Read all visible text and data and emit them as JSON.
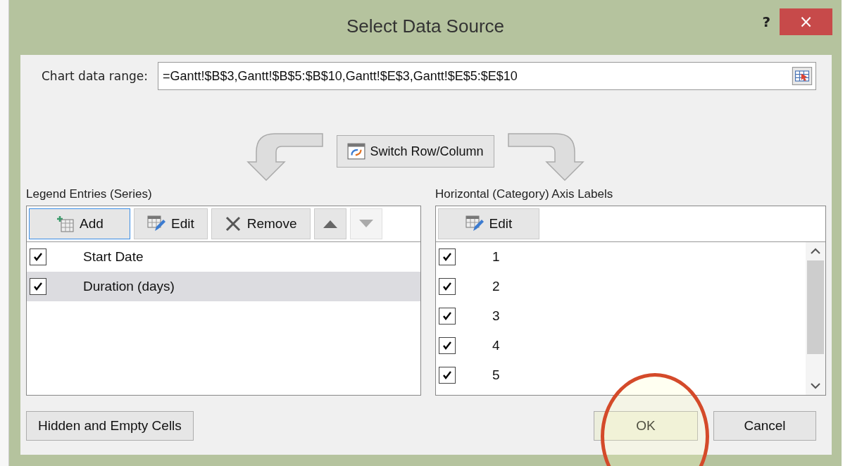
{
  "window": {
    "title": "Select Data Source",
    "help": "?",
    "close": "×"
  },
  "chart_data_range": {
    "label": "Chart data range:",
    "value": "=Gantt!$B$3,Gantt!$B$5:$B$10,Gantt!$E$3,Gantt!$E$5:$E$10"
  },
  "switch_button": "Switch Row/Column",
  "legend": {
    "title": "Legend Entries (Series)",
    "buttons": [
      {
        "kind": "add",
        "label": "Add"
      },
      {
        "kind": "edit",
        "label": "Edit"
      },
      {
        "kind": "remove",
        "label": "Remove"
      },
      {
        "kind": "up",
        "disabled": false
      },
      {
        "kind": "down",
        "disabled": true
      }
    ],
    "items": [
      {
        "label": "Start Date",
        "checked": true,
        "selected": false
      },
      {
        "label": "Duration (days)",
        "checked": true,
        "selected": true
      }
    ]
  },
  "axis": {
    "title": "Horizontal (Category) Axis Labels",
    "edit_button": "Edit",
    "items": [
      {
        "label": "1",
        "checked": true,
        "selected": false
      },
      {
        "label": "2",
        "checked": true,
        "selected": false
      },
      {
        "label": "3",
        "checked": true,
        "selected": false
      },
      {
        "label": "4",
        "checked": true,
        "selected": false
      },
      {
        "label": "5",
        "checked": true,
        "selected": false
      }
    ]
  },
  "buttons": {
    "hidden": "Hidden and Empty Cells",
    "ok": "OK",
    "cancel": "Cancel"
  }
}
